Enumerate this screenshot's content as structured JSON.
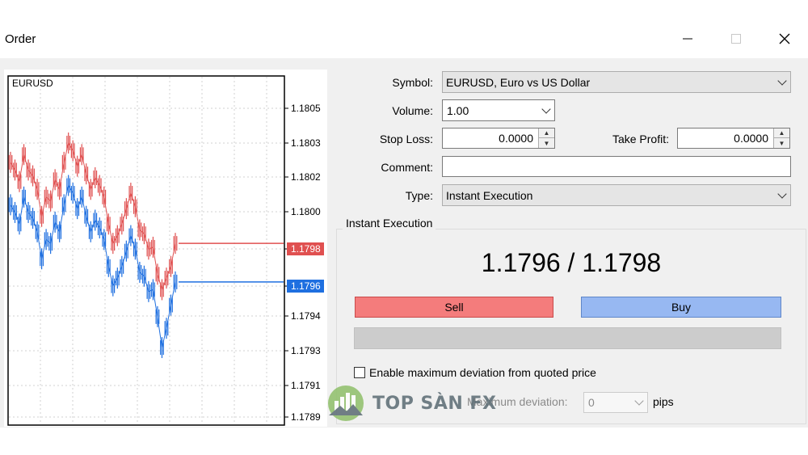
{
  "window": {
    "title": "Order"
  },
  "chart": {
    "symbol": "EURUSD",
    "price_ticks": [
      "1.1805",
      "1.1803",
      "1.1802",
      "1.1800",
      "1.1798",
      "1.1796",
      "1.1794",
      "1.1793",
      "1.1791",
      "1.1789"
    ],
    "ask_label": "1.1798",
    "bid_label": "1.1796",
    "ask_color": "#e05050",
    "bid_color": "#1e6fe0",
    "ask_series": [
      1.18022,
      1.18018,
      1.18012,
      1.18026,
      1.18018,
      1.18015,
      1.18008,
      1.17994,
      1.18004,
      1.18002,
      1.18013,
      1.18008,
      1.18022,
      1.18032,
      1.18028,
      1.1802,
      1.18026,
      1.18016,
      1.18008,
      1.18014,
      1.1801,
      1.18004,
      1.1799,
      1.1798,
      1.17984,
      1.1799,
      1.17998,
      1.18006,
      1.17999,
      1.17987,
      1.17985,
      1.17977,
      1.17978,
      1.17964,
      1.17956,
      1.17962,
      1.17968,
      1.1798
    ],
    "bid_series": [
      1.18,
      1.17996,
      1.1799,
      1.18004,
      1.17996,
      1.17993,
      1.17986,
      1.17972,
      1.17982,
      1.1798,
      1.17991,
      1.17986,
      1.18,
      1.1801,
      1.18006,
      1.17998,
      1.18004,
      1.17994,
      1.17986,
      1.17992,
      1.17988,
      1.17982,
      1.17968,
      1.17958,
      1.17962,
      1.17968,
      1.17976,
      1.17984,
      1.17977,
      1.17965,
      1.17963,
      1.17955,
      1.17956,
      1.17942,
      1.17926,
      1.17936,
      1.17948,
      1.1796
    ],
    "ask_level": 1.1798,
    "bid_level": 1.1796
  },
  "form": {
    "symbol_label": "Symbol:",
    "symbol_value": "EURUSD, Euro vs US Dollar",
    "volume_label": "Volume:",
    "volume_value": "1.00",
    "stop_loss_label": "Stop Loss:",
    "stop_loss_value": "0.0000",
    "take_profit_label": "Take Profit:",
    "take_profit_value": "0.0000",
    "comment_label": "Comment:",
    "comment_value": "",
    "type_label": "Type:",
    "type_value": "Instant Execution"
  },
  "execution": {
    "group_title": "Instant Execution",
    "quote": "1.1796 / 1.1798",
    "sell_label": "Sell",
    "buy_label": "Buy",
    "sell_color": "#f47c7c",
    "buy_color": "#97b8f2",
    "deviation_checkbox_label": "Enable maximum deviation from quoted price",
    "deviation_checked": false,
    "max_deviation_label": "Maximum deviation:",
    "max_deviation_value": "0",
    "pips_label": "pips"
  },
  "watermark": {
    "text": "TOP SÀN FX"
  }
}
